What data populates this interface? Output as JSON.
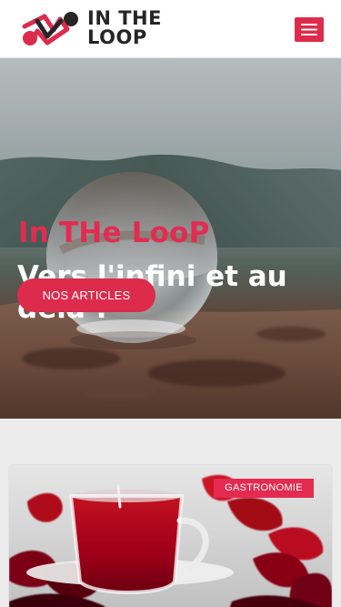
{
  "header": {
    "brand_line_1": "IN THE",
    "brand_line_2": "LOOP",
    "menu_icon": "hamburger-menu-icon"
  },
  "hero": {
    "kicker": "In THe LooP",
    "title": "Vers l'infini et au delà !",
    "button_label": "NOS ARTICLES",
    "image_subject": "crystal ball on rocks"
  },
  "article": {
    "category": "GASTRONOMIE",
    "image_subject": "red tea with flowers"
  },
  "colors": {
    "accent": "#dd2b4c",
    "accent_alt": "#e32b51",
    "text_dark": "#262626",
    "background": "#ececec"
  }
}
